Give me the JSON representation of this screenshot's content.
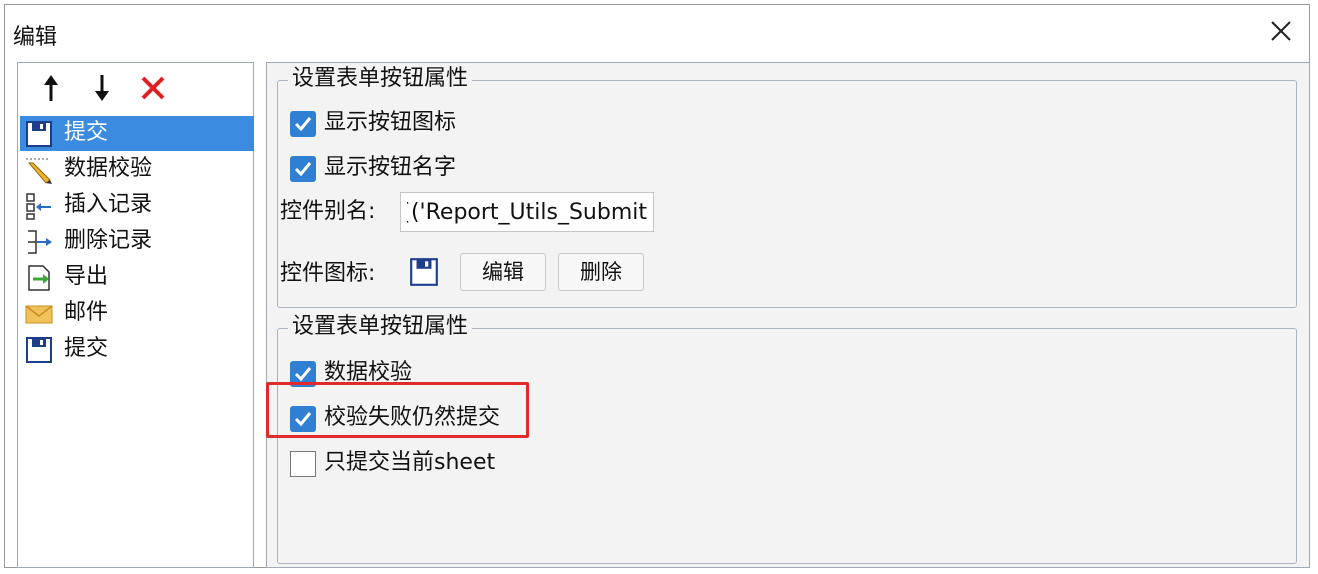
{
  "dialog": {
    "title": "编辑",
    "close_icon": "close-icon"
  },
  "toolbar": {
    "move_up_icon": "arrow-up-icon",
    "move_down_icon": "arrow-down-icon",
    "delete_icon": "delete-x-icon"
  },
  "tree": {
    "items": [
      {
        "label": "提交",
        "icon": "save-icon",
        "selected": true
      },
      {
        "label": "数据校验",
        "icon": "validate-pencil-icon"
      },
      {
        "label": "插入记录",
        "icon": "insert-record-icon"
      },
      {
        "label": "删除记录",
        "icon": "delete-record-icon"
      },
      {
        "label": "导出",
        "icon": "export-icon"
      },
      {
        "label": "邮件",
        "icon": "mail-icon"
      },
      {
        "label": "提交",
        "icon": "save-icon"
      }
    ]
  },
  "group1": {
    "legend": "设置表单按钮属性",
    "show_icon": {
      "label": "显示按钮图标",
      "checked": true
    },
    "show_name": {
      "label": "显示按钮名字",
      "checked": true
    },
    "alias_label": "控件别名:",
    "alias_value": "Report_Utils_Submit')}",
    "icon_label": "控件图标:",
    "icon_preview": "save-icon",
    "edit_button": "编辑",
    "delete_button": "删除"
  },
  "group2": {
    "legend": "设置表单按钮属性",
    "validate": {
      "label": "数据校验",
      "checked": true
    },
    "submit_on_fail": {
      "label": "校验失败仍然提交",
      "checked": true
    },
    "current_sheet_only": {
      "label": "只提交当前sheet",
      "checked": false
    }
  },
  "colors": {
    "selection": "#3b8be0",
    "checkbox": "#2f7fd3",
    "highlight": "#e12b2b"
  }
}
